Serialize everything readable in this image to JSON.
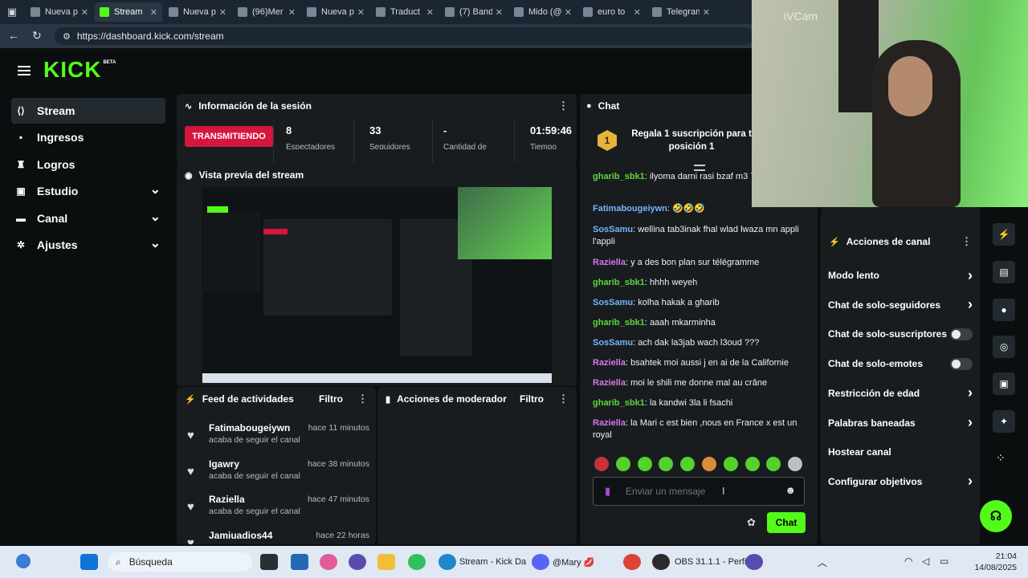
{
  "browser": {
    "tabs": [
      {
        "label": "Nueva p",
        "icon": "page-icon",
        "active": false
      },
      {
        "label": "Stream",
        "icon": "kick-icon",
        "active": true
      },
      {
        "label": "Nueva p",
        "icon": "page-icon",
        "active": false
      },
      {
        "label": "(96)Mer",
        "icon": "tiktok-icon",
        "active": false
      },
      {
        "label": "Nueva p",
        "icon": "page-icon",
        "active": false
      },
      {
        "label": "Traduct",
        "icon": "translate-icon",
        "active": false
      },
      {
        "label": "(7) Band",
        "icon": "instagram-icon",
        "active": false
      },
      {
        "label": "Mido (@",
        "icon": "tiktok-icon",
        "active": false
      },
      {
        "label": "euro to",
        "icon": "search-icon",
        "active": false
      },
      {
        "label": "Telegran",
        "icon": "telegram-icon",
        "active": false
      }
    ],
    "url": "https://dashboard.kick.com/stream"
  },
  "brand": {
    "logo": "KICK",
    "beta": "BETA",
    "accent": "#53fc18"
  },
  "sidebar": {
    "items": [
      {
        "label": "Stream",
        "icon": "stream-icon",
        "active": true
      },
      {
        "label": "Ingresos",
        "icon": "revenue-icon"
      },
      {
        "label": "Logros",
        "icon": "trophy-icon"
      },
      {
        "label": "Estudio",
        "icon": "studio-icon",
        "expandable": true
      },
      {
        "label": "Canal",
        "icon": "channel-icon",
        "expandable": true
      },
      {
        "label": "Ajustes",
        "icon": "gear-icon",
        "expandable": true
      }
    ]
  },
  "session": {
    "title": "Información de la sesión",
    "live_badge": "TRANSMITIENDO",
    "stats": [
      {
        "value": "8",
        "label": "Espectadores"
      },
      {
        "value": "33",
        "label": "Seguidores"
      },
      {
        "value": "-",
        "label": "Cantidad de"
      },
      {
        "value": "01:59:46",
        "label": "Tiempo"
      }
    ]
  },
  "preview": {
    "title": "Vista previa del stream"
  },
  "feed": {
    "title": "Feed de actividades",
    "filter": "Filtro",
    "items": [
      {
        "name": "Fatimabougeiywn",
        "time": "hace 11 minutos",
        "action": "acaba de seguir el canal"
      },
      {
        "name": "Igawry",
        "time": "hace 38 minutos",
        "action": "acaba de seguir el canal"
      },
      {
        "name": "Raziella",
        "time": "hace 47 minutos",
        "action": "acaba de seguir el canal"
      },
      {
        "name": "Jamiuadios44",
        "time": "hace 22 horas",
        "action": ""
      }
    ]
  },
  "mod_actions": {
    "title": "Acciones de moderador",
    "filter": "Filtro"
  },
  "chat": {
    "title": "Chat",
    "pinned": "Regala 1 suscripción para t posición 1",
    "pinned_rank": "1",
    "messages": [
      {
        "user": "gharib_sbk1",
        "text": "ilyoma darni rasi bzaf m3 7arara",
        "color": "#5ad83a"
      },
      {
        "user": "Fatimabougeiywn",
        "text": "🤣🤣🤣",
        "color": "#73b4ff"
      },
      {
        "user": "SosSamu",
        "text": "wellina tab3inak fhal wlad lwaza mn appli l'appli",
        "color": "#73b4ff"
      },
      {
        "user": "Raziella",
        "text": "y a des bon plan sur télégramme",
        "color": "#d478e6"
      },
      {
        "user": "gharib_sbk1",
        "text": "hhhh weyeh",
        "color": "#5ad83a"
      },
      {
        "user": "SosSamu",
        "text": "kolha hakak a gharib",
        "color": "#73b4ff"
      },
      {
        "user": "gharib_sbk1",
        "text": "aaah mkarminha",
        "color": "#5ad83a"
      },
      {
        "user": "SosSamu",
        "text": "ach dak la3jab wach l3oud ???",
        "color": "#73b4ff"
      },
      {
        "user": "Raziella",
        "text": "bsahtek moi aussi j en ai de la Californie",
        "color": "#d478e6"
      },
      {
        "user": "Raziella",
        "text": "moi le shili me donne mal au crâne",
        "color": "#d478e6"
      },
      {
        "user": "gharib_sbk1",
        "text": "la kandwi 3la li fsachi",
        "color": "#5ad83a"
      },
      {
        "user": "Raziella",
        "text": "la Mari c est bien ,nous en France x est un royal",
        "color": "#d478e6"
      }
    ],
    "input_placeholder": "Enviar un mensaje",
    "send_label": "Chat"
  },
  "channel_actions": {
    "title": "Acciones de canal",
    "items": [
      {
        "label": "Modo lento",
        "control": "chevron"
      },
      {
        "label": "Chat de solo-seguidores",
        "control": "chevron"
      },
      {
        "label": "Chat de solo-suscriptores",
        "control": "toggle"
      },
      {
        "label": "Chat de solo-emotes",
        "control": "toggle"
      },
      {
        "label": "Restricción de edad",
        "control": "chevron"
      },
      {
        "label": "Palabras baneadas",
        "control": "chevron"
      },
      {
        "label": "Hostear canal",
        "control": "none"
      },
      {
        "label": "Configurar objetivos",
        "control": "chevron"
      }
    ]
  },
  "webcam": {
    "watermark": "iVCam"
  },
  "taskbar": {
    "search": "Búsqueda",
    "apps": [
      {
        "label": "Stream - Kick Da"
      },
      {
        "label": "@Mary 💋"
      },
      {
        "label": "OBS 31.1.1 - Perfi"
      }
    ],
    "time": "21:04",
    "date": "14/08/2025"
  }
}
